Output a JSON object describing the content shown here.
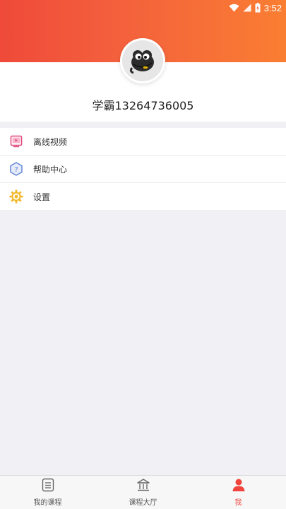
{
  "status_bar": {
    "time": "3:52",
    "icons": [
      "wifi-icon",
      "signal-icon",
      "battery-charging-icon"
    ]
  },
  "profile": {
    "username": "学霸13264736005",
    "avatar_icon": "cartoon-bird-avatar"
  },
  "menu": {
    "items": [
      {
        "label": "离线视频",
        "icon": "offline-video-icon",
        "color": "#e0457b"
      },
      {
        "label": "帮助中心",
        "icon": "help-hexagon-icon",
        "color": "#5b7fd6"
      },
      {
        "label": "设置",
        "icon": "gear-icon",
        "color": "#f2b92c"
      }
    ]
  },
  "tab_bar": {
    "tabs": [
      {
        "label": "我的课程",
        "icon": "course-list-icon",
        "active": false
      },
      {
        "label": "课程大厅",
        "icon": "hall-building-icon",
        "active": false
      },
      {
        "label": "我",
        "icon": "person-icon",
        "active": true
      }
    ],
    "active_color": "#f0443c"
  },
  "colors": {
    "header_gradient_start": "#ef4a3a",
    "header_gradient_end": "#fa7e32",
    "background": "#f1f1f5"
  }
}
